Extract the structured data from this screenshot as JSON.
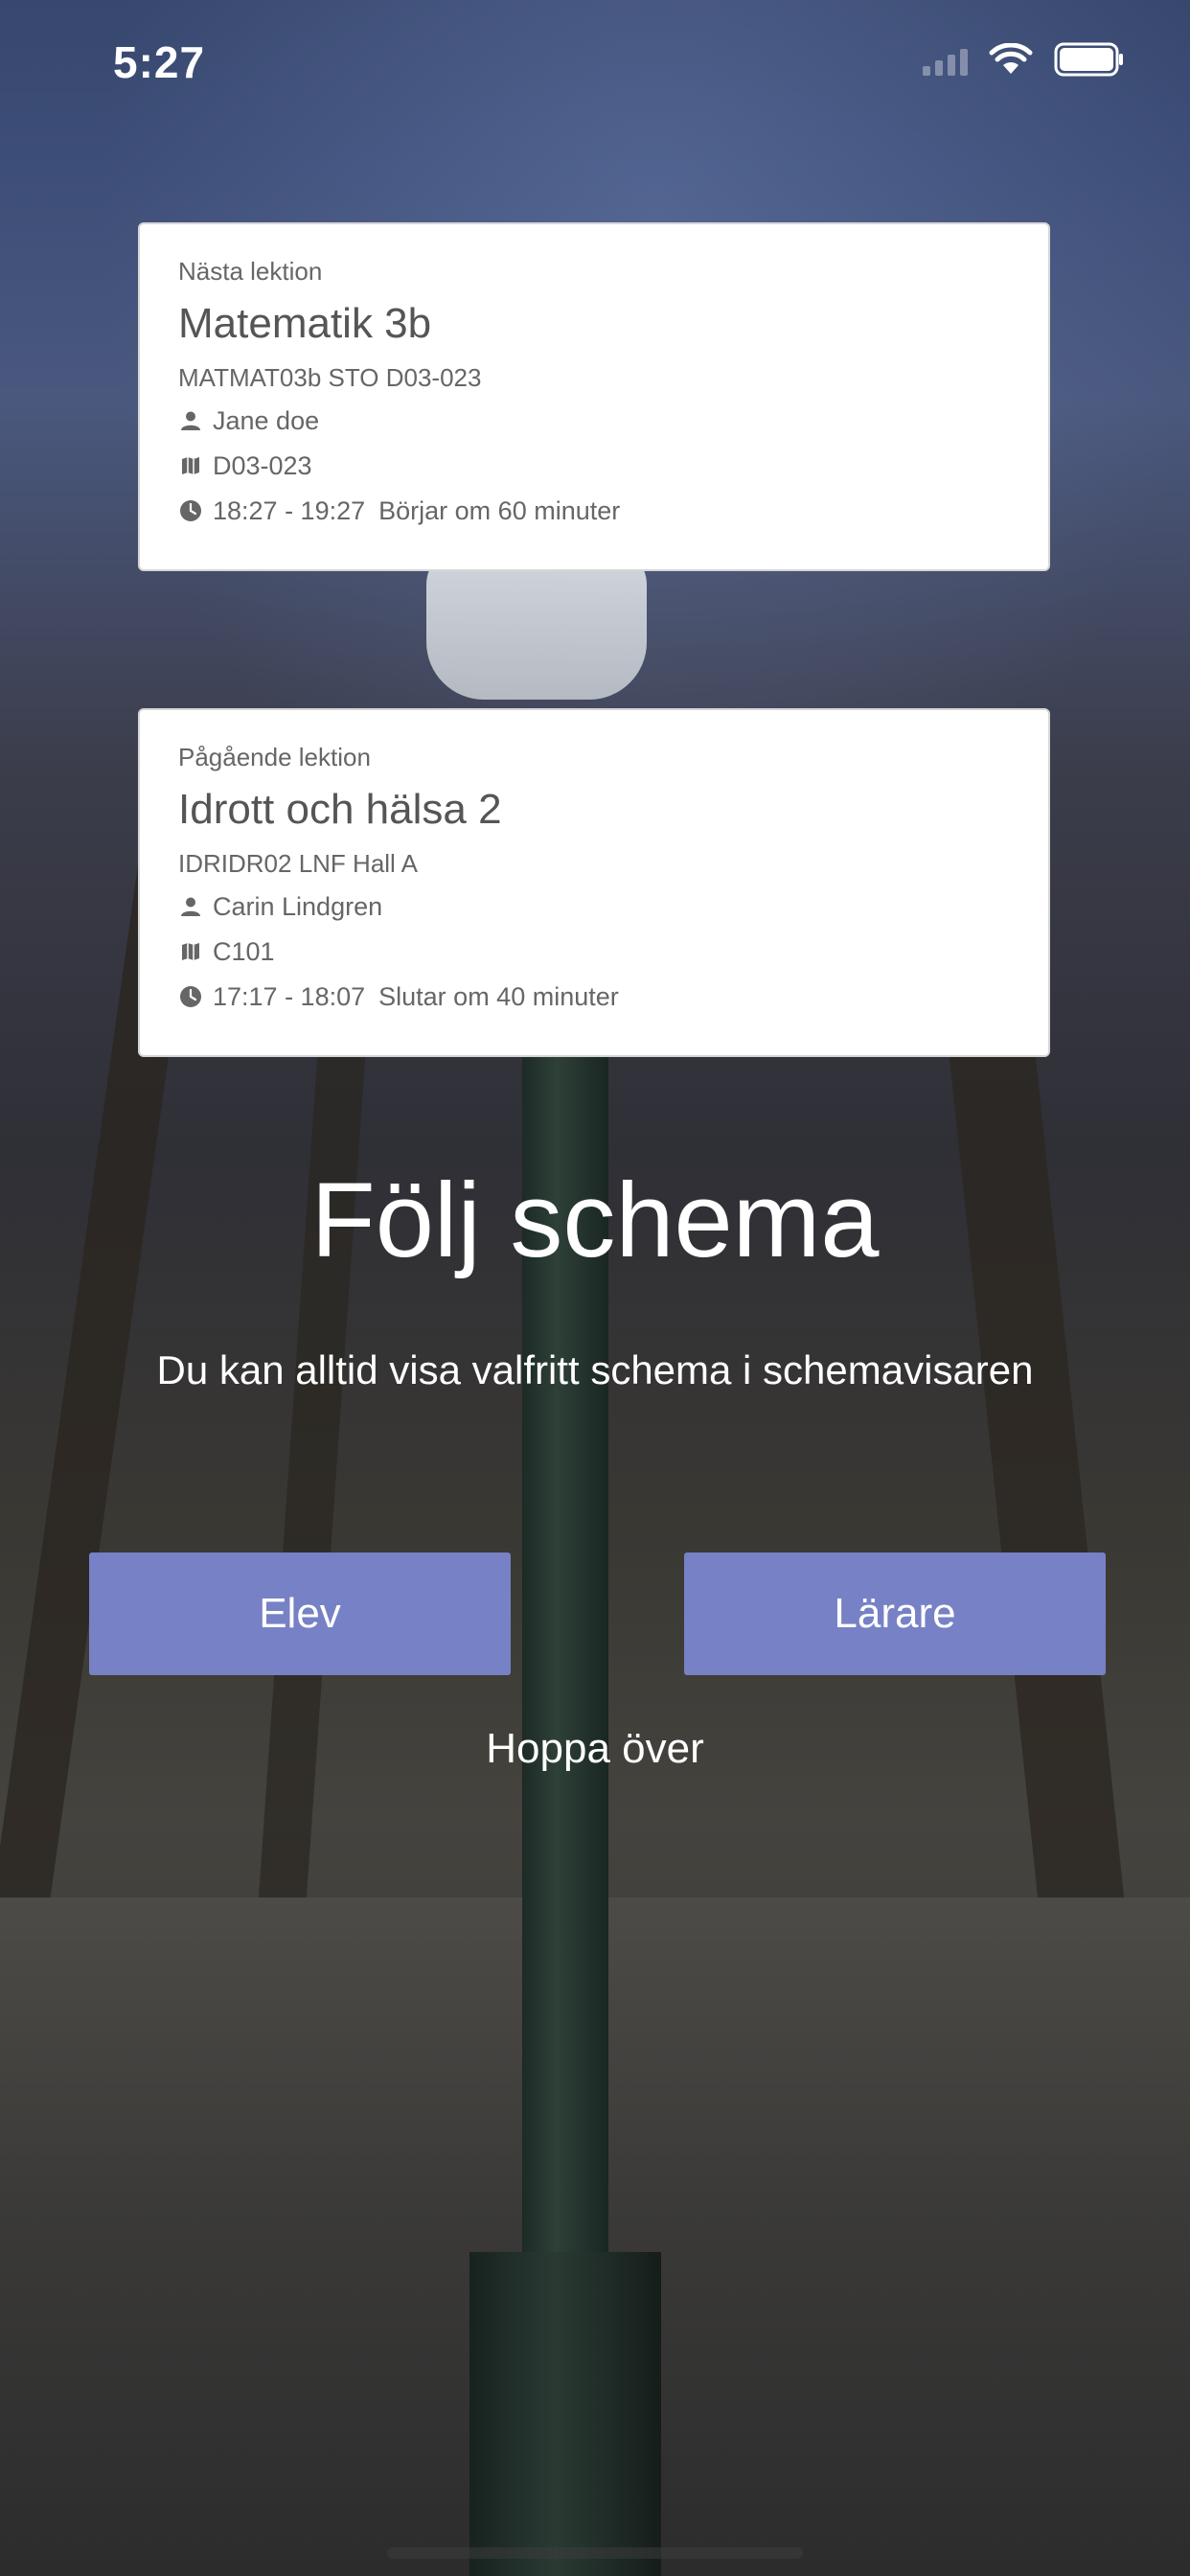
{
  "status_bar": {
    "time": "5:27",
    "signal_icon": "cellular-signal-icon",
    "wifi_icon": "wifi-icon",
    "battery_icon": "battery-icon"
  },
  "next_lesson": {
    "label": "Nästa lektion",
    "title": "Matematik 3b",
    "code": "MATMAT03b STO D03-023",
    "teacher": "Jane doe",
    "room": "D03-023",
    "time": "18:27 - 19:27",
    "relative": "Börjar om 60 minuter"
  },
  "current_lesson": {
    "label": "Pågående lektion",
    "title": "Idrott och hälsa 2",
    "code": "IDRIDR02 LNF Hall A",
    "teacher": "Carin Lindgren",
    "room": "C101",
    "time": "17:17 - 18:07",
    "relative": "Slutar om 40 minuter"
  },
  "headline": "Följ schema",
  "subline": "Du kan alltid visa valfritt schema i schemavisaren",
  "buttons": {
    "student": "Elev",
    "teacher": "Lärare",
    "skip": "Hoppa över"
  },
  "colors": {
    "button_bg": "#7781c5",
    "card_bg": "#ffffff",
    "text_on_bg": "#ffffff"
  }
}
